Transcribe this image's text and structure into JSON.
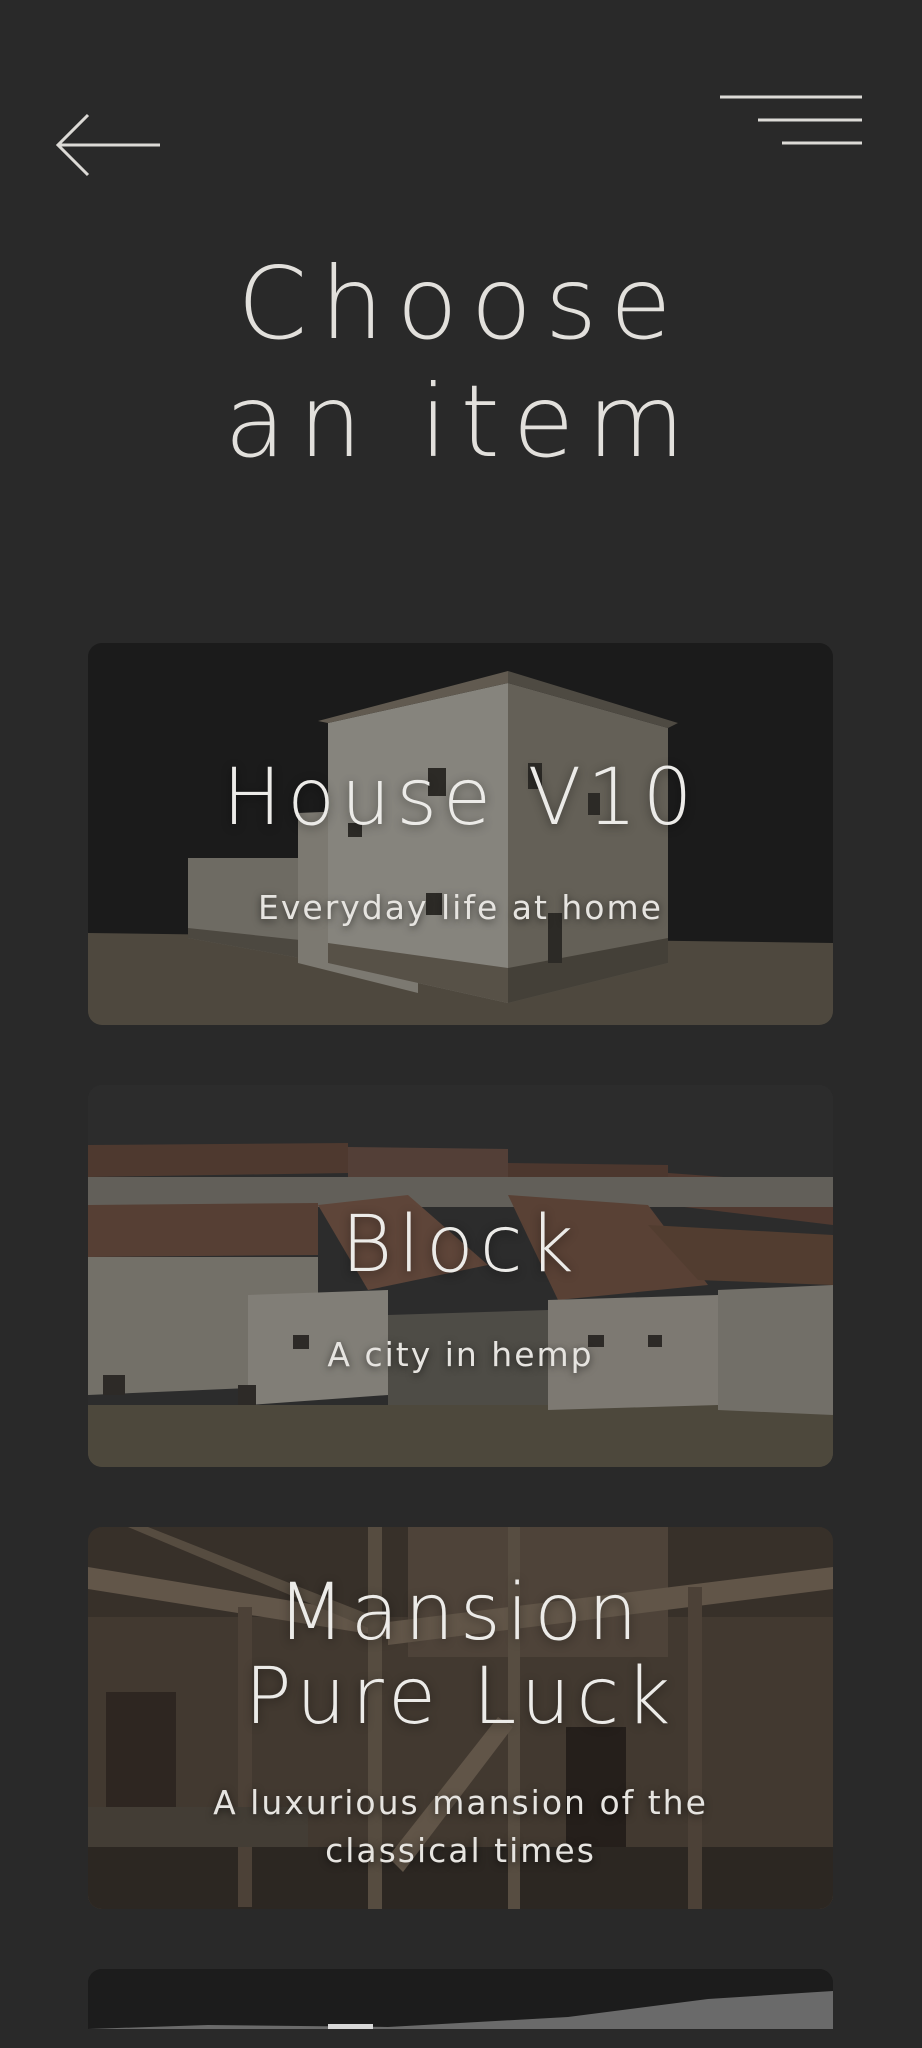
{
  "header": {
    "back_icon": "arrow-left-icon",
    "menu_icon": "hamburger-menu-icon"
  },
  "page": {
    "title_line1": "Choose",
    "title_line2": "an item"
  },
  "items": [
    {
      "title": "House V10",
      "subtitle": "Everyday life at home"
    },
    {
      "title": "Block",
      "subtitle": "A city in hemp"
    },
    {
      "title_line1": "Mansion",
      "title_line2": "Pure Luck",
      "subtitle_line1": "A luxurious mansion of the",
      "subtitle_line2": "classical times"
    }
  ],
  "colors": {
    "background": "#292929",
    "text": "#e2e0dc",
    "card_overlay": "#141414"
  }
}
